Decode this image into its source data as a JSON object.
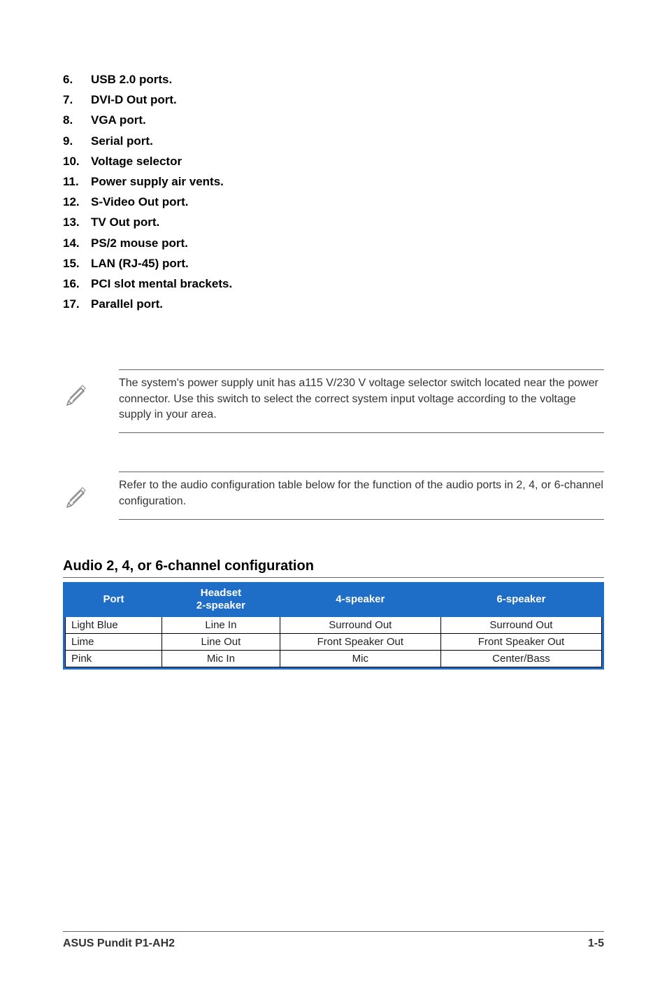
{
  "ports": [
    {
      "num": "6.",
      "label": "USB 2.0 ports."
    },
    {
      "num": "7.",
      "label": "DVI-D Out port."
    },
    {
      "num": "8.",
      "label": "VGA port."
    },
    {
      "num": "9.",
      "label": "Serial port."
    },
    {
      "num": "10.",
      "label": "Voltage selector"
    },
    {
      "num": "11.",
      "label": "Power supply air vents."
    },
    {
      "num": "12.",
      "label": "S-Video Out port."
    },
    {
      "num": "13.",
      "label": "TV Out port."
    },
    {
      "num": "14.",
      "label": "PS/2 mouse port."
    },
    {
      "num": "15.",
      "label": "LAN (RJ-45) port."
    },
    {
      "num": "16.",
      "label": "PCI slot mental brackets."
    },
    {
      "num": "17.",
      "label": "Parallel port."
    }
  ],
  "notes": {
    "note1": "The system's power supply unit has a115 V/230 V voltage selector switch located near the power connector. Use this switch to select the correct system input voltage according to the voltage supply in your area.",
    "note2": "Refer to the audio configuration table below for the function of the audio ports in 2, 4, or 6-channel configuration."
  },
  "audio_section_title": "Audio 2, 4, or 6-channel configuration",
  "audio_table": {
    "headers": {
      "port": "Port",
      "headset": "Headset 2-speaker",
      "four": "4-speaker",
      "six": "6-speaker"
    },
    "rows": [
      {
        "port": "Light Blue",
        "headset": "Line In",
        "four": "Surround Out",
        "six": "Surround Out"
      },
      {
        "port": "Lime",
        "headset": "Line Out",
        "four": "Front Speaker Out",
        "six": "Front Speaker Out"
      },
      {
        "port": "Pink",
        "headset": "Mic In",
        "four": "Mic",
        "six": "Center/Bass"
      }
    ]
  },
  "footer": {
    "left": "ASUS Pundit P1-AH2",
    "right": "1-5"
  }
}
